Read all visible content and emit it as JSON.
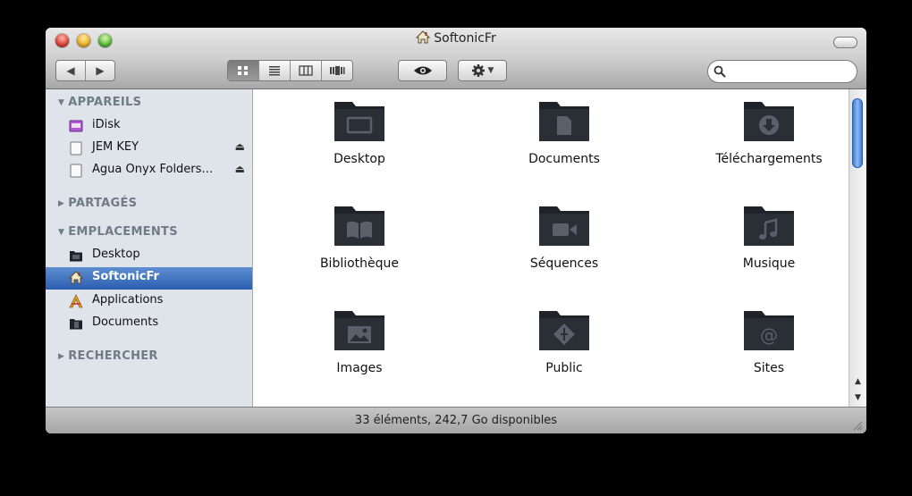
{
  "window": {
    "title": "SoftonicFr"
  },
  "toolbar": {
    "back_icon": "back-arrow-icon",
    "forward_icon": "forward-arrow-icon",
    "view_modes": [
      "icon-view-icon",
      "list-view-icon",
      "column-view-icon",
      "coverflow-view-icon"
    ],
    "active_view": 0,
    "quicklook_icon": "eye-icon",
    "action_icon": "gear-icon",
    "search": {
      "value": "",
      "placeholder": ""
    }
  },
  "sidebar": {
    "sections": [
      {
        "label": "APPAREILS",
        "expanded": true
      },
      {
        "label": "PARTAGÉS",
        "expanded": false
      },
      {
        "label": "EMPLACEMENTS",
        "expanded": true
      },
      {
        "label": "RECHERCHER",
        "expanded": false
      }
    ],
    "devices": [
      {
        "label": "iDisk",
        "icon": "idisk-icon"
      },
      {
        "label": "JEM KEY",
        "icon": "drive-icon",
        "eject": true
      },
      {
        "label": "Agua Onyx Folders…",
        "icon": "drive-icon",
        "eject": true
      }
    ],
    "places": [
      {
        "label": "Desktop",
        "icon": "desktop-folder-icon"
      },
      {
        "label": "SoftonicFr",
        "icon": "home-icon",
        "selected": true
      },
      {
        "label": "Applications",
        "icon": "applications-icon"
      },
      {
        "label": "Documents",
        "icon": "documents-folder-icon"
      }
    ]
  },
  "folders": [
    {
      "name": "Desktop",
      "icon": "desktop-folder-icon"
    },
    {
      "name": "Documents",
      "icon": "documents-folder-icon"
    },
    {
      "name": "Téléchargements",
      "icon": "downloads-folder-icon"
    },
    {
      "name": "Bibliothèque",
      "icon": "library-folder-icon"
    },
    {
      "name": "Séquences",
      "icon": "movies-folder-icon"
    },
    {
      "name": "Musique",
      "icon": "music-folder-icon"
    },
    {
      "name": "Images",
      "icon": "pictures-folder-icon"
    },
    {
      "name": "Public",
      "icon": "public-folder-icon"
    },
    {
      "name": "Sites",
      "icon": "sites-folder-icon"
    }
  ],
  "status": {
    "text": "33 éléments, 242,7 Go disponibles"
  },
  "colors": {
    "selection": "#2a5db0",
    "sidebar_bg": "#dee4ea",
    "folder": "#1f2329",
    "folder_glyph": "#5a606a"
  }
}
